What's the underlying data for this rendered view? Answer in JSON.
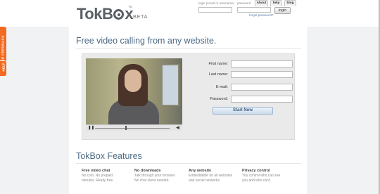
{
  "header": {
    "logo_text_a": "Tok",
    "logo_text_b": "B",
    "logo_text_c": "x",
    "trademark": "TM",
    "beta": "BETA"
  },
  "login": {
    "username_label": "login (email or username)",
    "password_label": "password",
    "username_value": "",
    "password_value": "",
    "login_button": "login",
    "forgot_link": "forgot password?"
  },
  "nav": {
    "tabs": [
      {
        "label": "About"
      },
      {
        "label": "help"
      },
      {
        "label": "blog"
      }
    ]
  },
  "sidebar": {
    "feedback_label": "GIVE FEEDBACK",
    "help_label": "HELP"
  },
  "main": {
    "headline": "Free video calling from any website."
  },
  "video": {
    "play_icon": "pause-icon",
    "volume_icon": "speaker-icon",
    "seek_progress": 0.41
  },
  "signup": {
    "fields": [
      {
        "label": "First name:",
        "value": ""
      },
      {
        "label": "Last name:",
        "value": ""
      },
      {
        "label": "E-mail:",
        "value": ""
      },
      {
        "label": "Password:",
        "value": ""
      }
    ],
    "submit": "Start Now"
  },
  "features": {
    "title": "TokBox Features",
    "items": [
      {
        "title": "Free video chat",
        "desc_1": "No cost. No prepaid",
        "desc_2": "minutes. Really free."
      },
      {
        "title": "No downloads",
        "desc_1": "Talk through your browser.",
        "desc_2": "No chat client needed."
      },
      {
        "title": "Any website",
        "desc_1": "Embeddable on all websites",
        "desc_2": "and social networks."
      },
      {
        "title": "Privacy control",
        "desc_1": "You control who can see",
        "desc_2": "you and who can't."
      }
    ]
  },
  "colors": {
    "accent": "#4e6b86",
    "feedback_tab": "#f26b21",
    "background_band": "#f0f2f4"
  }
}
